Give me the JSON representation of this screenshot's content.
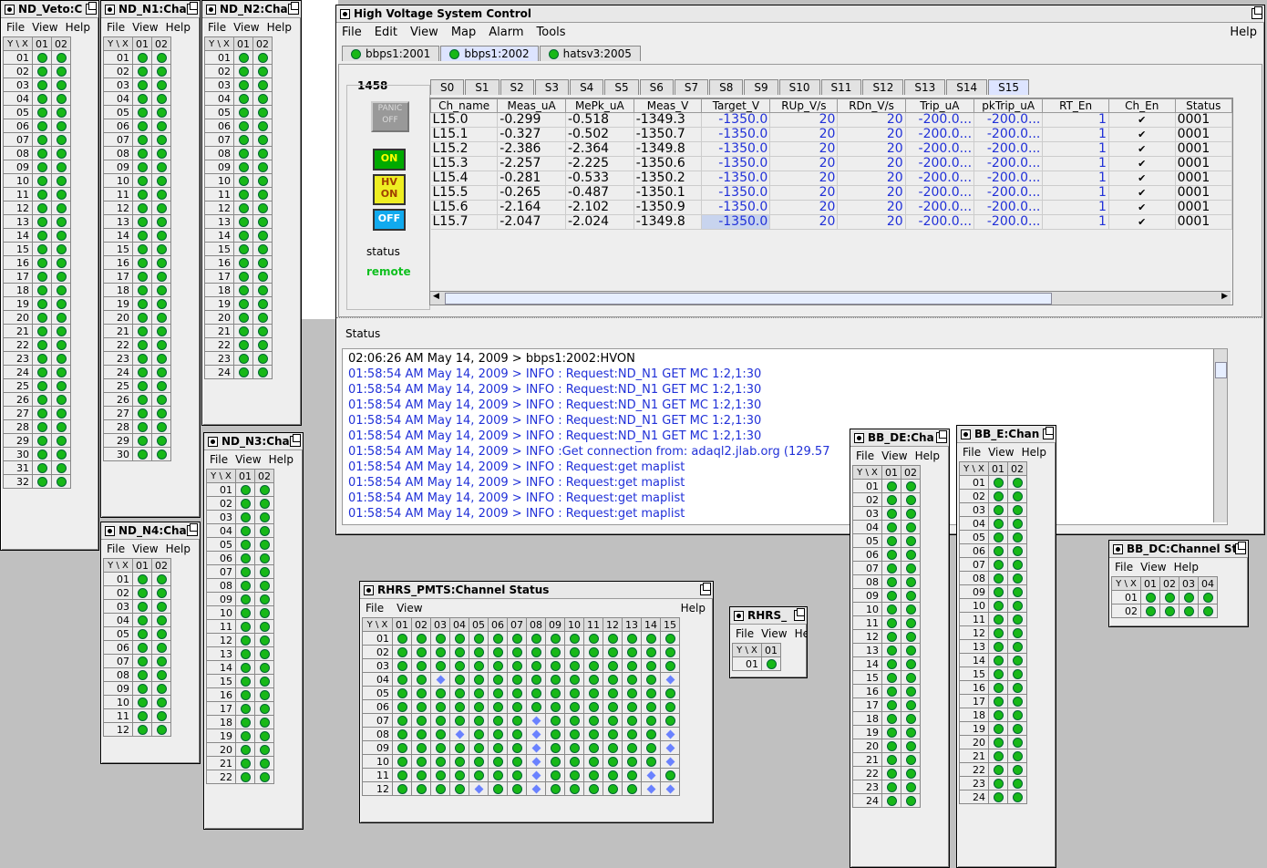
{
  "menus": {
    "file": "File",
    "edit": "Edit",
    "view": "View",
    "map": "Map",
    "alarm": "Alarm",
    "tools": "Tools",
    "help": "Help"
  },
  "grid_header": {
    "yx": "Y \\ X",
    "rows_prefix": ""
  },
  "small_windows": [
    {
      "id": "veto",
      "title": "ND_Veto:C",
      "cols": [
        "01",
        "02"
      ],
      "rows": 32
    },
    {
      "id": "n1",
      "title": "ND_N1:Cha",
      "cols": [
        "01",
        "02"
      ],
      "rows": 30
    },
    {
      "id": "n2",
      "title": "ND_N2:Cha",
      "cols": [
        "01",
        "02"
      ],
      "rows": 24
    },
    {
      "id": "n3",
      "title": "ND_N3:Cha",
      "cols": [
        "01",
        "02"
      ],
      "rows": 22
    },
    {
      "id": "n4",
      "title": "ND_N4:Cha",
      "cols": [
        "01",
        "02"
      ],
      "rows": 12
    },
    {
      "id": "bbde",
      "title": "BB_DE:Cha",
      "cols": [
        "01",
        "02"
      ],
      "rows": 24
    },
    {
      "id": "bbe",
      "title": "BB_E:Chan",
      "cols": [
        "01",
        "02"
      ],
      "rows": 24
    },
    {
      "id": "bbdc",
      "title": "BB_DC:Channel St",
      "cols": [
        "01",
        "02",
        "03",
        "04"
      ],
      "rows": 2
    },
    {
      "id": "rhrs",
      "title": "RHRS_",
      "cols": [
        "01"
      ],
      "rows": 1,
      "menu": [
        "File",
        "View",
        "Help"
      ]
    }
  ],
  "hv": {
    "title": "High Voltage System Control",
    "crate_tabs": [
      "bbps1:2001",
      "bbps1:2002",
      "hatsv3:2005"
    ],
    "crate_selected": 1,
    "crate_number": "1458",
    "panic_label": "PANIC OFF",
    "on_label": "ON",
    "hvon_label": "HV ON",
    "off_label": "OFF",
    "status_label": "status",
    "status_value": "remote",
    "slot_tabs": [
      "S0",
      "S1",
      "S2",
      "S3",
      "S4",
      "S5",
      "S6",
      "S7",
      "S8",
      "S9",
      "S10",
      "S11",
      "S12",
      "S13",
      "S14",
      "S15"
    ],
    "slot_selected": 15,
    "columns": [
      "Ch_name",
      "Meas_uA",
      "MePk_uA",
      "Meas_V",
      "Target_V",
      "RUp_V/s",
      "RDn_V/s",
      "Trip_uA",
      "pkTrip_uA",
      "RT_En",
      "Ch_En",
      "Status"
    ],
    "rows": [
      [
        "L15.0",
        "-0.299",
        "-0.518",
        "-1349.3",
        "-1350.0",
        "20",
        "20",
        "-200.0...",
        "-200.0...",
        "1",
        "✔",
        "0001"
      ],
      [
        "L15.1",
        "-0.327",
        "-0.502",
        "-1350.7",
        "-1350.0",
        "20",
        "20",
        "-200.0...",
        "-200.0...",
        "1",
        "✔",
        "0001"
      ],
      [
        "L15.2",
        "-2.386",
        "-2.364",
        "-1349.8",
        "-1350.0",
        "20",
        "20",
        "-200.0...",
        "-200.0...",
        "1",
        "✔",
        "0001"
      ],
      [
        "L15.3",
        "-2.257",
        "-2.225",
        "-1350.6",
        "-1350.0",
        "20",
        "20",
        "-200.0...",
        "-200.0...",
        "1",
        "✔",
        "0001"
      ],
      [
        "L15.4",
        "-0.281",
        "-0.533",
        "-1350.2",
        "-1350.0",
        "20",
        "20",
        "-200.0...",
        "-200.0...",
        "1",
        "✔",
        "0001"
      ],
      [
        "L15.5",
        "-0.265",
        "-0.487",
        "-1350.1",
        "-1350.0",
        "20",
        "20",
        "-200.0...",
        "-200.0...",
        "1",
        "✔",
        "0001"
      ],
      [
        "L15.6",
        "-2.164",
        "-2.102",
        "-1350.9",
        "-1350.0",
        "20",
        "20",
        "-200.0...",
        "-200.0...",
        "1",
        "✔",
        "0001"
      ],
      [
        "L15.7",
        "-2.047",
        "-2.024",
        "-1349.8",
        "-1350.0",
        "20",
        "20",
        "-200.0...",
        "-200.0...",
        "1",
        "✔",
        "0001"
      ]
    ],
    "status_title": "Status",
    "log": [
      "02:06:26 AM May 14, 2009 > bbps1:2002:HVON",
      "01:58:54 AM May 14, 2009 > INFO : Request:ND_N1 GET MC 1:2,1:30",
      "01:58:54 AM May 14, 2009 > INFO : Request:ND_N1 GET MC 1:2,1:30",
      "01:58:54 AM May 14, 2009 > INFO : Request:ND_N1 GET MC 1:2,1:30",
      "01:58:54 AM May 14, 2009 > INFO : Request:ND_N1 GET MC 1:2,1:30",
      "01:58:54 AM May 14, 2009 > INFO : Request:ND_N1 GET MC 1:2,1:30",
      "01:58:54 AM May 14, 2009 > INFO :Get connection from: adaql2.jlab.org (129.57",
      "01:58:54 AM May 14, 2009 > INFO : Request:get maplist",
      "01:58:54 AM May 14, 2009 > INFO : Request:get maplist",
      "01:58:54 AM May 14, 2009 > INFO : Request:get maplist",
      "01:58:54 AM May 14, 2009 > INFO : Request:get maplist"
    ]
  },
  "rhrs_pmts": {
    "title": "RHRS_PMTS:Channel Status",
    "cols": [
      "01",
      "02",
      "03",
      "04",
      "05",
      "06",
      "07",
      "08",
      "09",
      "10",
      "11",
      "12",
      "13",
      "14",
      "15"
    ],
    "rows": [
      "01",
      "02",
      "03",
      "04",
      "05",
      "06",
      "07",
      "08",
      "09",
      "10",
      "11",
      "12"
    ],
    "off_cells": [
      "04-03",
      "04-15",
      "07-08",
      "08-04",
      "08-08",
      "08-15",
      "09-08",
      "09-15",
      "10-08",
      "10-15",
      "11-08",
      "11-14",
      "12-05",
      "12-08",
      "12-14",
      "12-15"
    ]
  },
  "colors": {
    "led_on": "#18b818",
    "led_off": "#6a82ff",
    "log_text": "#2030d8",
    "remote": "#10c020"
  }
}
